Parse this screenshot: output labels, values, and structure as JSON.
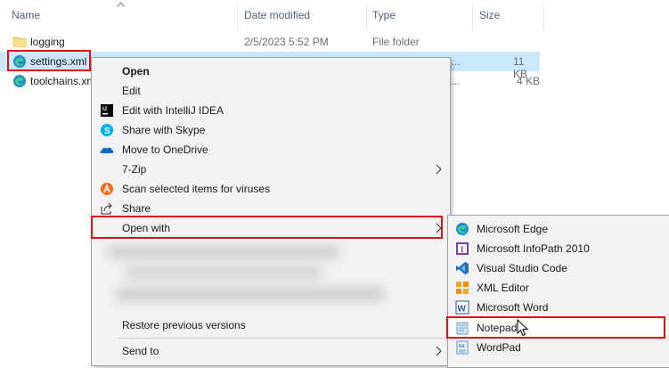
{
  "columns": {
    "name": "Name",
    "date_modified": "Date modified",
    "type": "Type",
    "size": "Size"
  },
  "files": [
    {
      "name": "logging",
      "date": "2/5/2023 5:52 PM",
      "type": "File folder",
      "size": "",
      "icon": "folder-icon"
    },
    {
      "name": "settings.xml",
      "date": "",
      "type": "H...",
      "size": "11 KB",
      "icon": "edge-xml-icon"
    },
    {
      "name": "toolchains.xml",
      "date": "",
      "type": "H...",
      "size": "4 KB",
      "icon": "edge-xml-icon"
    }
  ],
  "context_menu": {
    "items": [
      {
        "label": "Open",
        "icon": "none"
      },
      {
        "label": "Edit",
        "icon": "none"
      },
      {
        "label": "Edit with IntelliJ IDEA",
        "icon": "intellij-icon"
      },
      {
        "label": "Share with Skype",
        "icon": "skype-icon"
      },
      {
        "label": "Move to OneDrive",
        "icon": "onedrive-icon"
      },
      {
        "label": "7-Zip",
        "icon": "none"
      },
      {
        "label": "Scan selected items for viruses",
        "icon": "avast-icon"
      },
      {
        "label": "Share",
        "icon": "share-icon"
      },
      {
        "label": "Open with",
        "icon": "none"
      },
      {
        "label": "Restore previous versions",
        "icon": "none"
      },
      {
        "label": "Send to",
        "icon": "none"
      }
    ]
  },
  "open_with_menu": {
    "items": [
      {
        "label": "Microsoft Edge",
        "icon": "edge-icon"
      },
      {
        "label": "Microsoft InfoPath 2010",
        "icon": "infopath-icon"
      },
      {
        "label": "Visual Studio Code",
        "icon": "vscode-icon"
      },
      {
        "label": "XML Editor",
        "icon": "xml-editor-icon"
      },
      {
        "label": "Microsoft Word",
        "icon": "word-icon"
      },
      {
        "label": "Notepad",
        "icon": "notepad-icon"
      },
      {
        "label": "WordPad",
        "icon": "wordpad-icon"
      }
    ]
  },
  "colors": {
    "highlight_box": "#e0101a",
    "selection": "#cce8ff",
    "menu_bg": "#f2f2f2",
    "header_text": "#4c607a"
  }
}
